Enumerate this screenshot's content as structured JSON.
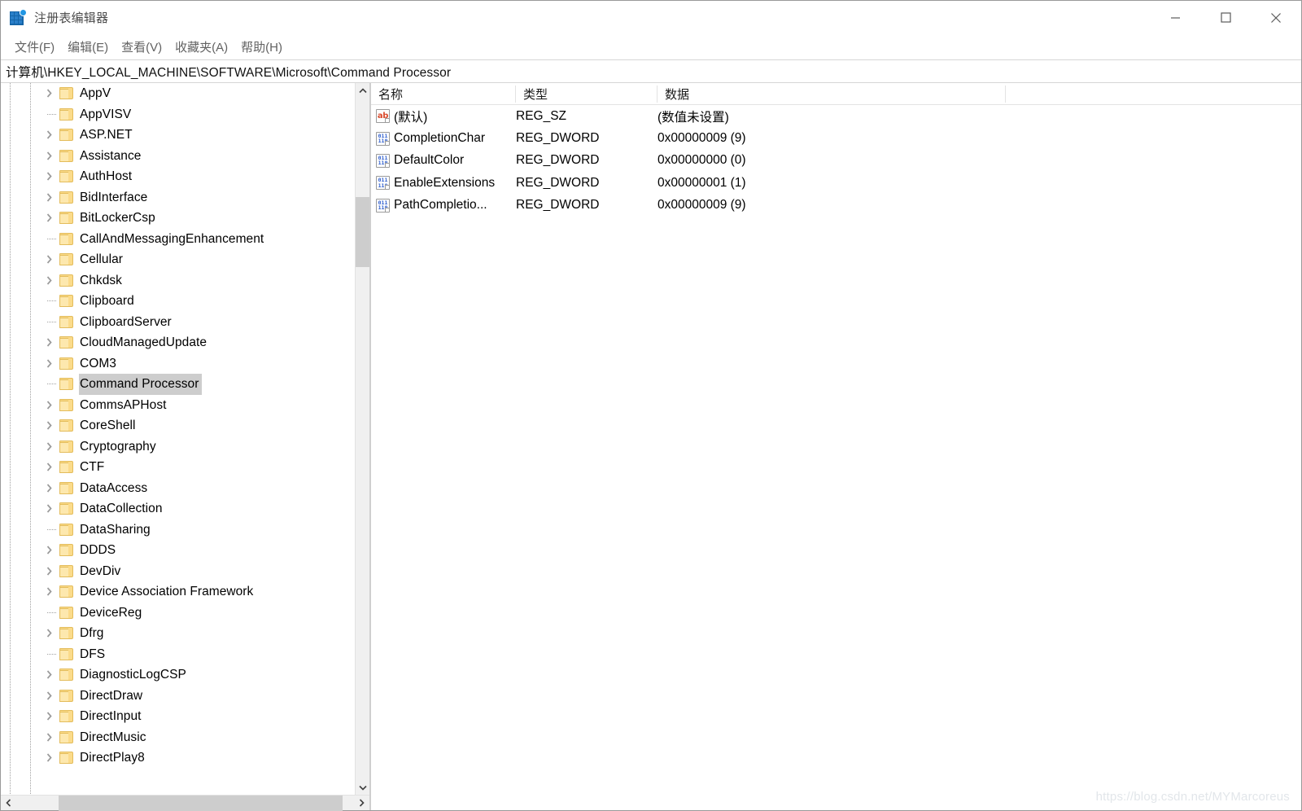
{
  "window": {
    "title": "注册表编辑器",
    "app_icon": "registry-editor-icon",
    "controls": {
      "minimize": "—",
      "maximize": "□",
      "close": "✕"
    }
  },
  "menubar": {
    "items": [
      {
        "label": "文件(F)",
        "name": "menu-file"
      },
      {
        "label": "编辑(E)",
        "name": "menu-edit"
      },
      {
        "label": "查看(V)",
        "name": "menu-view"
      },
      {
        "label": "收藏夹(A)",
        "name": "menu-favorites"
      },
      {
        "label": "帮助(H)",
        "name": "menu-help"
      }
    ]
  },
  "address": {
    "path": "计算机\\HKEY_LOCAL_MACHINE\\SOFTWARE\\Microsoft\\Command Processor"
  },
  "tree": {
    "nodes": [
      {
        "label": "AppV",
        "expandable": true,
        "selected": false
      },
      {
        "label": "AppVISV",
        "expandable": false,
        "selected": false
      },
      {
        "label": "ASP.NET",
        "expandable": true,
        "selected": false
      },
      {
        "label": "Assistance",
        "expandable": true,
        "selected": false
      },
      {
        "label": "AuthHost",
        "expandable": true,
        "selected": false
      },
      {
        "label": "BidInterface",
        "expandable": true,
        "selected": false
      },
      {
        "label": "BitLockerCsp",
        "expandable": true,
        "selected": false
      },
      {
        "label": "CallAndMessagingEnhancement",
        "expandable": false,
        "selected": false
      },
      {
        "label": "Cellular",
        "expandable": true,
        "selected": false
      },
      {
        "label": "Chkdsk",
        "expandable": true,
        "selected": false
      },
      {
        "label": "Clipboard",
        "expandable": false,
        "selected": false
      },
      {
        "label": "ClipboardServer",
        "expandable": false,
        "selected": false
      },
      {
        "label": "CloudManagedUpdate",
        "expandable": true,
        "selected": false
      },
      {
        "label": "COM3",
        "expandable": true,
        "selected": false
      },
      {
        "label": "Command Processor",
        "expandable": false,
        "selected": true
      },
      {
        "label": "CommsAPHost",
        "expandable": true,
        "selected": false
      },
      {
        "label": "CoreShell",
        "expandable": true,
        "selected": false
      },
      {
        "label": "Cryptography",
        "expandable": true,
        "selected": false
      },
      {
        "label": "CTF",
        "expandable": true,
        "selected": false
      },
      {
        "label": "DataAccess",
        "expandable": true,
        "selected": false
      },
      {
        "label": "DataCollection",
        "expandable": true,
        "selected": false
      },
      {
        "label": "DataSharing",
        "expandable": false,
        "selected": false
      },
      {
        "label": "DDDS",
        "expandable": true,
        "selected": false
      },
      {
        "label": "DevDiv",
        "expandable": true,
        "selected": false
      },
      {
        "label": "Device Association Framework",
        "expandable": true,
        "selected": false
      },
      {
        "label": "DeviceReg",
        "expandable": false,
        "selected": false
      },
      {
        "label": "Dfrg",
        "expandable": true,
        "selected": false
      },
      {
        "label": "DFS",
        "expandable": false,
        "selected": false
      },
      {
        "label": "DiagnosticLogCSP",
        "expandable": true,
        "selected": false
      },
      {
        "label": "DirectDraw",
        "expandable": true,
        "selected": false
      },
      {
        "label": "DirectInput",
        "expandable": true,
        "selected": false
      },
      {
        "label": "DirectMusic",
        "expandable": true,
        "selected": false
      },
      {
        "label": "DirectPlay8",
        "expandable": true,
        "selected": false
      }
    ],
    "vscroll": {
      "up_icon": "chevron-up-icon",
      "down_icon": "chevron-down-icon"
    },
    "hscroll": {
      "left_icon": "chevron-left-icon",
      "right_icon": "chevron-right-icon"
    }
  },
  "list": {
    "columns": [
      "名称",
      "类型",
      "数据"
    ],
    "rows": [
      {
        "icon": "string-value-icon",
        "icon_kind": "sz",
        "name": "(默认)",
        "type": "REG_SZ",
        "data": "(数值未设置)"
      },
      {
        "icon": "dword-value-icon",
        "icon_kind": "dword",
        "name": "CompletionChar",
        "type": "REG_DWORD",
        "data": "0x00000009 (9)"
      },
      {
        "icon": "dword-value-icon",
        "icon_kind": "dword",
        "name": "DefaultColor",
        "type": "REG_DWORD",
        "data": "0x00000000 (0)"
      },
      {
        "icon": "dword-value-icon",
        "icon_kind": "dword",
        "name": "EnableExtensions",
        "type": "REG_DWORD",
        "data": "0x00000001 (1)"
      },
      {
        "icon": "dword-value-icon",
        "icon_kind": "dword",
        "name": "PathCompletio...",
        "type": "REG_DWORD",
        "data": "0x00000009 (9)"
      }
    ]
  },
  "watermark": {
    "text": "https://blog.csdn.net/MYMarcoreus"
  },
  "colors": {
    "folder_fill": "#fde8ae",
    "folder_edge": "#e3bc5b",
    "selection": "#cdcdcd",
    "string_icon": "#d9492b",
    "dword_icon": "#2f5fd0",
    "scrollbar_thumb": "#cdcdcd"
  }
}
